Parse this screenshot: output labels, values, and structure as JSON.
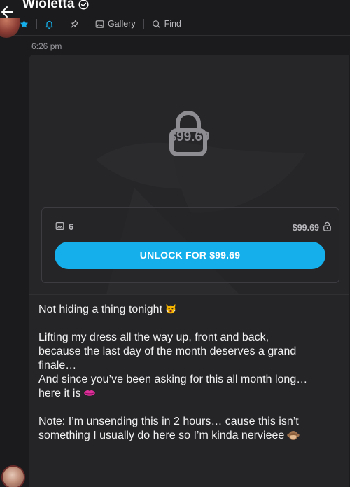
{
  "header": {
    "title": "Wioletta",
    "toolbar": {
      "gallery_label": "Gallery",
      "find_label": "Find"
    }
  },
  "message": {
    "timestamp": "6:26 pm",
    "locked_price_overlay": "$99.69",
    "media_count": "6",
    "price_label": "$99.69",
    "unlock_button_label": "UNLOCK FOR $99.69",
    "text_lines": {
      "l1": "Not hiding a thing tonight",
      "l2": "Lifting my dress all the way up, front and back,",
      "l3": "because the last day of the month deserves a grand",
      "l4": "finale…",
      "l5": "And since you’ve been asking for this all month long…",
      "l6": "here it is",
      "l7": "Note: I’m unsending this in 2 hours… cause this isn’t",
      "l8": "something I usually do here so I’m kinda nervieee"
    }
  },
  "colors": {
    "background": "#1b1b1d",
    "card": "#252528",
    "accent": "#15b0ec",
    "muted_text": "#9a9aa0"
  }
}
